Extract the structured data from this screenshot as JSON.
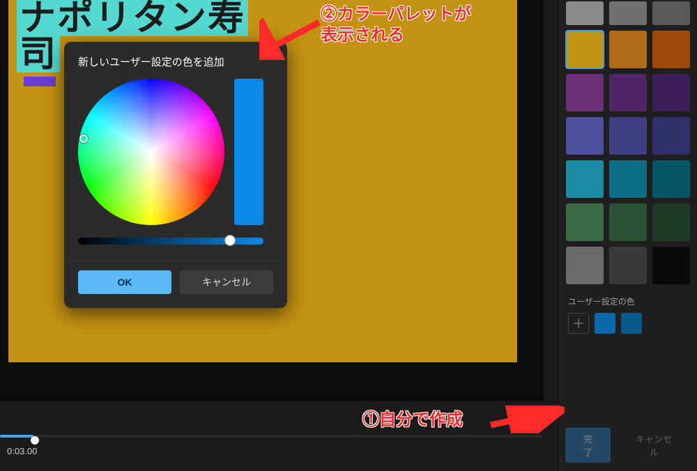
{
  "preview": {
    "title_line1": "ナポリタン寿",
    "title_line2": "司"
  },
  "dialog": {
    "title": "新しいユーザー設定の色を追加",
    "ok_label": "OK",
    "cancel_label": "キャンセル",
    "selected_color": "#0d8ae6"
  },
  "timeline": {
    "time": "0:03.00"
  },
  "sidebar": {
    "palette": [
      {
        "c": "#8a8a8a",
        "half": true
      },
      {
        "c": "#707070",
        "half": true
      },
      {
        "c": "#595959",
        "half": true
      },
      {
        "c": "#c39212",
        "selected": true
      },
      {
        "c": "#b06a18"
      },
      {
        "c": "#9e4a0e"
      },
      {
        "c": "#6a2f77"
      },
      {
        "c": "#502766"
      },
      {
        "c": "#3a1e55"
      },
      {
        "c": "#4d4f9e"
      },
      {
        "c": "#3e3f85"
      },
      {
        "c": "#30306a"
      },
      {
        "c": "#1d8aa3"
      },
      {
        "c": "#0d6f86"
      },
      {
        "c": "#065664"
      },
      {
        "c": "#3a6b46"
      },
      {
        "c": "#2c5236"
      },
      {
        "c": "#1e3b25"
      },
      {
        "c": "#6b6b6b"
      },
      {
        "c": "#3a3a3a"
      },
      {
        "c": "#0a0a0a"
      }
    ],
    "user_section_label": "ユーザー設定の色",
    "user_colors": [
      "#0d6aa8",
      "#0a5a90"
    ],
    "add_symbol": "＋",
    "done_label": "完了",
    "cancel_label": "キャンセル"
  },
  "annotations": {
    "a2": "②カラーパレットが\n表示される",
    "a1": "①自分で作成"
  }
}
